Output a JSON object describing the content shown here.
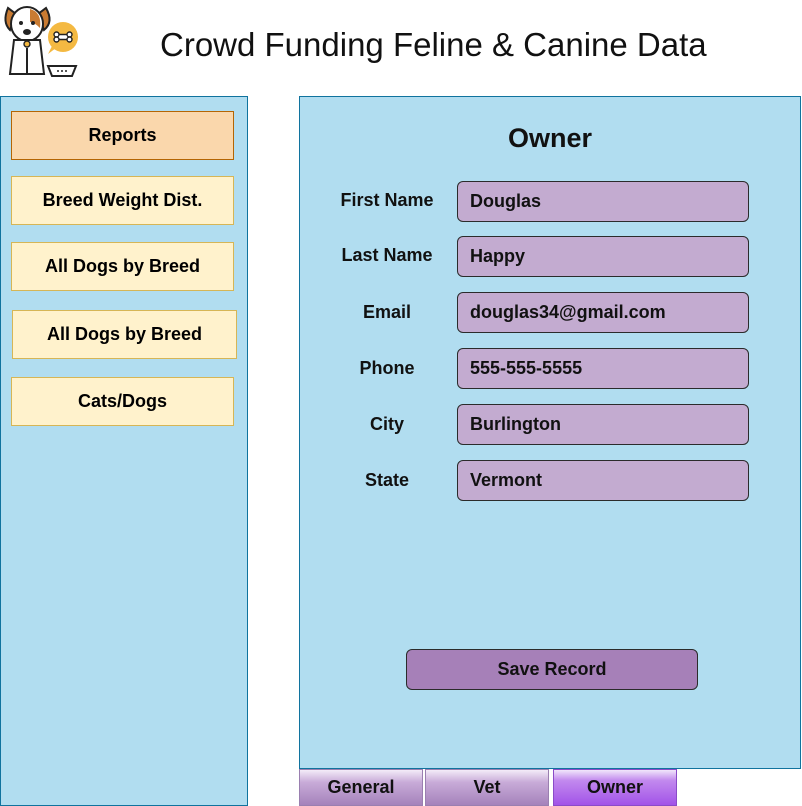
{
  "app": {
    "title": "Crowd Funding Feline & Canine Data",
    "logo_icon": "dog-with-bone-thought-icon"
  },
  "sidebar": {
    "items": [
      {
        "label": "Reports"
      },
      {
        "label": "Breed Weight Dist."
      },
      {
        "label": "All Dogs by Breed"
      },
      {
        "label": "All Dogs by Breed"
      },
      {
        "label": "Cats/Dogs"
      }
    ]
  },
  "form": {
    "title": "Owner",
    "fields": [
      {
        "label": "First Name",
        "value": "Douglas"
      },
      {
        "label": "Last Name",
        "value": "Happy"
      },
      {
        "label": "Email",
        "value": "douglas34@gmail.com"
      },
      {
        "label": "Phone",
        "value": "555-555-5555"
      },
      {
        "label": "City",
        "value": "Burlington"
      },
      {
        "label": "State",
        "value": "Vermont"
      }
    ],
    "save_label": "Save Record"
  },
  "tabs": [
    {
      "label": "General"
    },
    {
      "label": "Vet"
    },
    {
      "label": "Owner",
      "active": true
    }
  ],
  "colors": {
    "panel_bg": "#b1ddf0",
    "sidebar_button": "#fff2cc",
    "sidebar_header": "#fad7ac",
    "input_bg": "#c3abd0",
    "save_button": "#a680b8",
    "active_tab": "#a253e8"
  }
}
